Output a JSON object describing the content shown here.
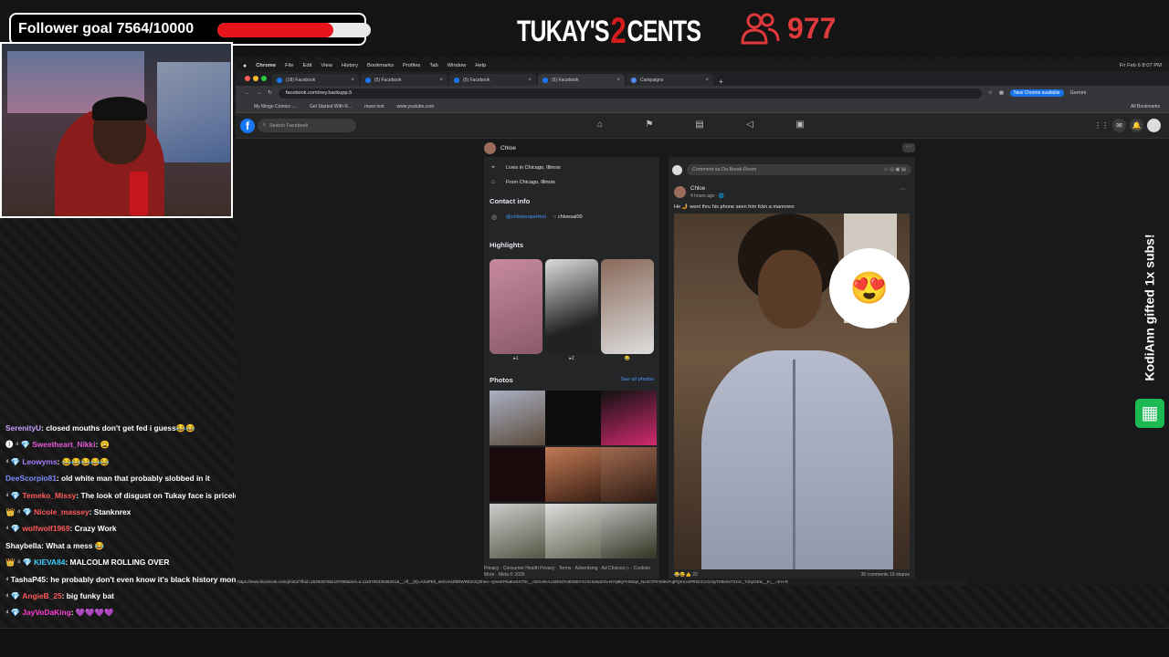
{
  "overlay": {
    "follower_goal_text": "Follower goal 7564/10000",
    "follower_goal_fraction": 0.7564,
    "logo_part1": "TUKAY'S",
    "logo_part2": "2",
    "logo_part3": "CENTS",
    "viewer_count": "977",
    "gift_alert": "KodiAnn gifted 1x subs!"
  },
  "chat": [
    {
      "badge": "",
      "user": "SerenityU",
      "user_color": "#c9a0ff",
      "text": "closed mouths don't get fed i guess😂😂"
    },
    {
      "badge": "🅘 ⁴ 💎",
      "user": "Sweetheart_Nikki",
      "user_color": "#e05bd6",
      "text": "😩"
    },
    {
      "badge": "⁴ 💎",
      "user": "Leowyms",
      "user_color": "#a67aff",
      "text": "😂😂😂😂😂"
    },
    {
      "badge": "",
      "user": "DeeScorpio81",
      "user_color": "#7e8aff",
      "text": "old    white man that probably slobbed in it"
    },
    {
      "badge": "⁴ 💎",
      "user": "Temeko_Missy",
      "user_color": "#ff5a5a",
      "text": "The look of disgust on Tukay face is priceless 😂😂"
    },
    {
      "badge": "👑 ⁴ 💎",
      "user": "Nicole_massey",
      "user_color": "#ff5a5a",
      "text": "Stanknrex"
    },
    {
      "badge": "⁴ 💎",
      "user": "wolfwolf1969",
      "user_color": "#ff5a5a",
      "text": "Crazy Work"
    },
    {
      "badge": "",
      "user": "Shaybella",
      "user_color": "#ffffff",
      "text": "What a mess 😂"
    },
    {
      "badge": "👑 ⁴ 💎",
      "user": "KIEVA84",
      "user_color": "#3fd0ff",
      "text": "MALCOLM ROLLING OVER"
    },
    {
      "badge": "⁴",
      "user": "TashaP45",
      "user_color": "#ffffff",
      "text": "he probably don't even know it's black history month"
    },
    {
      "badge": "⁴ 💎",
      "user": "AngieB_25",
      "user_color": "#ff5a5a",
      "text": "big funky bat"
    },
    {
      "badge": "⁴ 💎",
      "user": "JayVoDaKing",
      "user_color": "#ff3bd6",
      "text": "💜💜💜💜"
    }
  ],
  "macbar": {
    "app": "Chrome",
    "menus": [
      "File",
      "Edit",
      "View",
      "History",
      "Bookmarks",
      "Profiles",
      "Tab",
      "Window",
      "Help"
    ],
    "clock": "Fri Feb 6  8:07 PM"
  },
  "browser": {
    "tabs": [
      {
        "label": "(18) Facebook",
        "active": false
      },
      {
        "label": "(5) Facebook",
        "active": false
      },
      {
        "label": "(5) Facebook",
        "active": false
      },
      {
        "label": "(5) Facebook",
        "active": true
      },
      {
        "label": "Campaigns",
        "active": false
      }
    ],
    "url": "facebook.com/ney.backupp.5",
    "update_label": "New Chrome available",
    "gemini_label": "Gemini",
    "bookmarks": [
      "My Mingo Comics -...",
      "Get Started With R...",
      "mass text",
      "www.youtube.com"
    ],
    "all_bookmarks": "All Bookmarks",
    "status_url": "https://www.facebook.com/photo/?fbid=1539387654197069&set=a.111676533635341&__cft__[0]=AZaPEk_eKkUAUf5RWRbXOQlrhee--QmeEPkaEaXX7tD__AEGvIKAJJdKN7H4NN5YrCr2Ho9uZAlv-N7q9kp7HSIIqs_Ne3ClTKYelevFujPQKXcsPROnCzGc5yTrI8eSvTZCtc_TvbyGE&__tn__=EH-R"
  },
  "facebook": {
    "search_placeholder": "Search Facebook",
    "profile_name": "Chloe",
    "lives_in": "Lives in Chicago, Illinois",
    "from": "From Chicago, Illinois",
    "contact_info_title": "Contact info",
    "contact_handle": "@chloetooperfect",
    "contact_handle2": "◌ chloesal00",
    "highlights_title": "Highlights",
    "highlight_captions": [
      "▸1",
      "▸2",
      "😂"
    ],
    "photos_title": "Photos",
    "see_all_photos": "See all photos",
    "footer": "Privacy · Consumer Health Privacy · Terms · Advertising · Ad Choices ▷ · Cookies · More · Meta © 2026",
    "comment_placeholder": "Comment as Da Break Room",
    "post_author": "Chloe",
    "post_time": "4 hours ago · 🌐",
    "post_caption": "He 🤳 went thru his phone seen him fckn a mannnnn",
    "post_emoji": "😍",
    "comments_count": "30 comments",
    "shares_count": "19 shares",
    "reaction_icons": "😂😆👍 20"
  }
}
